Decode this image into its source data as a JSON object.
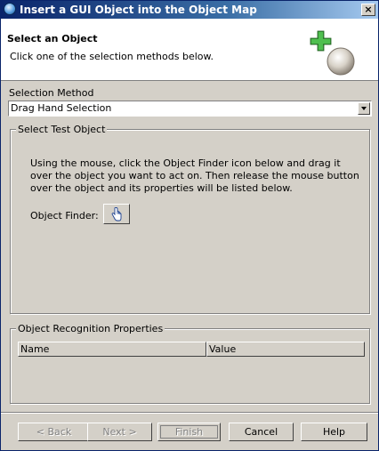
{
  "window": {
    "title": "Insert a GUI Object into the Object Map",
    "close_symbol": "×"
  },
  "header": {
    "title": "Select an Object",
    "description": "Click one of the selection methods below."
  },
  "selection": {
    "label": "Selection Method",
    "value": "Drag Hand Selection"
  },
  "test_object": {
    "legend": "Select Test Object",
    "instructions": "Using the mouse, click the Object Finder icon below and drag it over the object you want to act on. Then release the mouse button over the object and its properties will be listed below.",
    "finder_label": "Object Finder:",
    "finder_icon": "hand-pointer-icon"
  },
  "recognition": {
    "legend": "Object Recognition Properties",
    "columns": [
      "Name",
      "Value"
    ]
  },
  "buttons": {
    "back": "< Back",
    "next": "Next >",
    "finish": "Finish",
    "cancel": "Cancel",
    "help": "Help"
  }
}
